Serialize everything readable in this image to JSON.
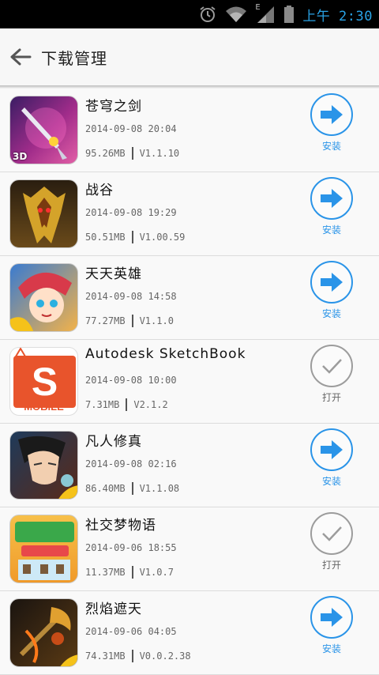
{
  "status_bar": {
    "time": "上午 2:30",
    "network_label": "E"
  },
  "header": {
    "title": "下载管理"
  },
  "apps": [
    {
      "name": "苍穹之剑",
      "date": "2014-09-08 20:04",
      "size": "95.26MB",
      "version": "V1.1.10",
      "action": "安装",
      "icon_label": "3D",
      "icon": "sword-icon"
    },
    {
      "name": "战谷",
      "date": "2014-09-08 19:29",
      "size": "50.51MB",
      "version": "V1.00.59",
      "action": "安装",
      "icon": "armor-icon"
    },
    {
      "name": "天天英雄",
      "date": "2014-09-08 14:58",
      "size": "77.27MB",
      "version": "V1.1.0",
      "action": "安装",
      "icon": "hero-icon"
    },
    {
      "name": "Autodesk SketchBook",
      "date": "2014-09-08 10:00",
      "size": "7.31MB",
      "version": "V2.1.2",
      "action": "打开",
      "icon_letter": "S",
      "icon_label": "MOBILE",
      "icon": "sketchbook-icon"
    },
    {
      "name": "凡人修真",
      "date": "2014-09-08 02:16",
      "size": "86.40MB",
      "version": "V1.1.08",
      "action": "安装",
      "icon": "warrior-icon"
    },
    {
      "name": "社交梦物语",
      "date": "2014-09-06 18:55",
      "size": "11.37MB",
      "version": "V1.0.7",
      "action": "打开",
      "icon": "social-game-icon"
    },
    {
      "name": "烈焰遮天",
      "date": "2014-09-06 04:05",
      "size": "74.31MB",
      "version": "V0.0.2.38",
      "action": "安装",
      "icon": "fire-axe-icon"
    }
  ]
}
